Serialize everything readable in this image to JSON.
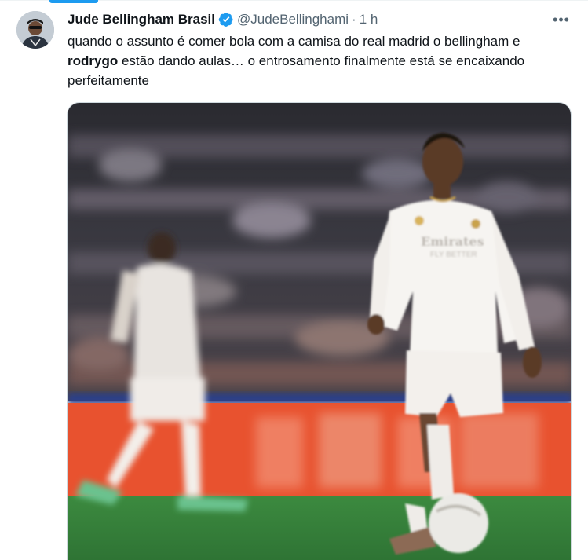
{
  "tweet": {
    "author_name": "Jude Bellingham Brasil",
    "handle": "@JudeBellinghami",
    "separator": "·",
    "time": "1 h",
    "text_part1": "quando o assunto é comer bola com a camisa do real madrid o bellingham e ",
    "text_bold": "rodrygo",
    "text_part2": " estão dando aulas… o entrosamento finalmente está se encaixando perfeitamente",
    "more_label": "•••",
    "photo": {
      "sponsor_line1": "Emirates",
      "sponsor_line2": "FLY BETTER"
    }
  },
  "colors": {
    "accent": "#1d9bf0",
    "secondary_text": "#536471",
    "verified": "#1d9bf0"
  },
  "icons": [
    "verified-badge-icon",
    "more-options-icon"
  ]
}
